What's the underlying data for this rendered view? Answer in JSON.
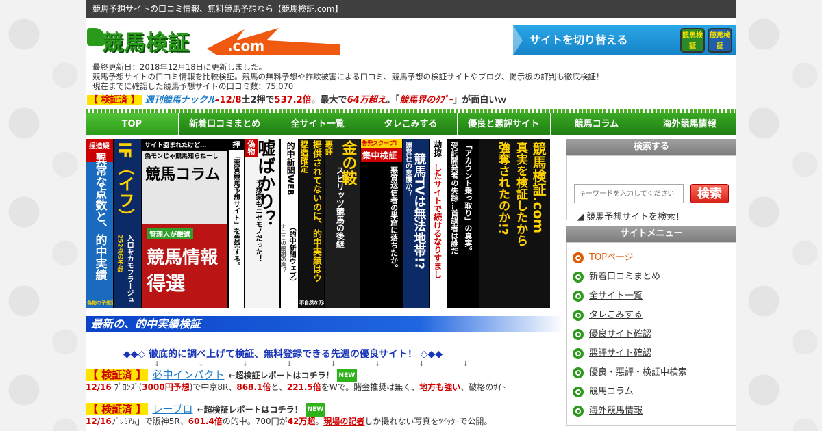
{
  "topbar": {
    "text": "競馬予想サイトの口コミ情報、無料競馬予想なら【競馬検証.com】"
  },
  "header": {
    "logo_text": "競馬検証",
    "logo_domain": ".com",
    "switch_label": "サイトを切り替える",
    "switch_logo_a": "競馬検証",
    "switch_logo_b": "競馬検証"
  },
  "updates": {
    "line1": "最終更新日：2018年12月18日に更新しました。",
    "line2": "競馬予想サイトの口コミ情報を比較検証。競馬の無料予想や詐欺被害による口コミ、競馬予想の検証サイトやブログ、掲示板の評判も徹底検証！",
    "line3": "現在までに確認した競馬予想サイトの口コミ数：75,070"
  },
  "ticker": {
    "badge": "【 検証済 】",
    "site": "週刊競馬ナックル",
    "date": "-12/8",
    "part1": "土2押で",
    "odds": "537.2倍",
    "part2": "。最大で",
    "payout": "64万超え",
    "part3": "。「",
    "boss": "競馬界のﾀﾌﾞｰ",
    "part4": "」が面白いｗ"
  },
  "nav": [
    {
      "label": "TOP"
    },
    {
      "label": "新着口コミまとめ"
    },
    {
      "label": "全サイト一覧"
    },
    {
      "label": "タレこみする"
    },
    {
      "label": "優良と悪評サイト"
    },
    {
      "label": "競馬コラム"
    },
    {
      "label": "海外競馬情報"
    }
  ],
  "banners": [
    {
      "top": "捏造疑惑",
      "body": "異常な点数と、的中実績",
      "foot": "偽物の予想家"
    },
    {
      "top": "IF（イフ）",
      "body": "入口をカモフラージュ",
      "foot": "252点の予想"
    },
    {
      "top": "サイト盗まれたけど…",
      "body": "偽モンじゃ競馬知らねーし",
      "foot": "競馬コラム"
    },
    {
      "top": "管理人が厳選",
      "body": "競馬情報",
      "foot": "得選"
    },
    {
      "top": "押",
      "body": "「悪質競馬予想サイト」を告発する。",
      "foot": ""
    },
    {
      "top": "偽物",
      "body": "嘘ばかり？",
      "foot": "予想家もニセモノだった！"
    },
    {
      "top": "的中新聞WEB",
      "body": "（的中新聞ウェブ）",
      "foot": "ナニこの感謝の声？"
    },
    {
      "top": "捏造確定",
      "body": "提供されてないのに、的中実績はウソ!!",
      "foot": "不自然な万札"
    },
    {
      "top": "悪評",
      "body": "スピリッツ競馬の後継",
      "foot": "金の鞍"
    },
    {
      "top": "告発スクープ！",
      "body": "集中検証",
      "foot": "悪質送信者の巣窟に落ちたか。"
    },
    {
      "top": "運営社の怠慢か？",
      "body": "競馬TVは無法地帯!?",
      "foot": ""
    },
    {
      "top": "劫掠",
      "body": "したサイトで続けるなりすまし",
      "foot": ""
    },
    {
      "top": "受託開発者の失踪…首謀者は誰だ",
      "body": "「アカウント乗っ取り」の真実。",
      "foot": ""
    },
    {
      "top": "強奪されたのか!?",
      "body": "真実を検証したから",
      "foot": "競馬検証.com"
    }
  ],
  "sidebar": {
    "search_title": "検索する",
    "search_placeholder": "キーワードを入力してください",
    "search_button": "検索",
    "search_link": "競馬予想サイトを検索！",
    "menu_title": "サイトメニュー",
    "menu": [
      {
        "label": "TOPページ",
        "active": true
      },
      {
        "label": "新着口コミまとめ"
      },
      {
        "label": "全サイト一覧"
      },
      {
        "label": "タレこみする"
      },
      {
        "label": "優良サイト確認"
      },
      {
        "label": "悪評サイト確認"
      },
      {
        "label": "優良・悪評・検証中検索"
      },
      {
        "label": "競馬コラム"
      },
      {
        "label": "海外競馬情報"
      }
    ]
  },
  "main": {
    "title": "最新の、的中実績検証",
    "promo": "◆◆◇ 徹底的に調べ上げて検証、無料登録できる先週の優良サイト！ ◇◆◆",
    "arrows": "↓↓↓↓↓↓↓↓",
    "entries": [
      {
        "badge": "【 検証済 】",
        "name": "必中インパクト",
        "note": "←超検証レポートはコチラ！",
        "new": "NEW",
        "date": "12/16",
        "t1": "ﾌﾟﾛﾝｽﾞ(",
        "pred": "3000円予想",
        "t2": ")で中京8R、",
        "odds1": "868.1倍",
        "t3": "と、",
        "odds2": "221.5倍",
        "t4": "をWで。",
        "u1": "賭金推奨は無く",
        "t5": "、",
        "u2": "地方も強い",
        "t6": "、破格のｻｲﾄ"
      },
      {
        "badge": "【 検証済 】",
        "name": "レープロ",
        "note": "←超検証レポートはコチラ！",
        "new": "NEW",
        "date": "12/16",
        "t1": "ﾌﾟﾚﾐｱﾑ」で阪神5R、",
        "odds1": "601.4倍",
        "t2": "の的中。700円が",
        "payout": "42万超",
        "t3": "。",
        "u1": "現場の記者",
        "t4": "しか撮れない写真をﾂｲｯﾀｰで公開。"
      }
    ]
  }
}
